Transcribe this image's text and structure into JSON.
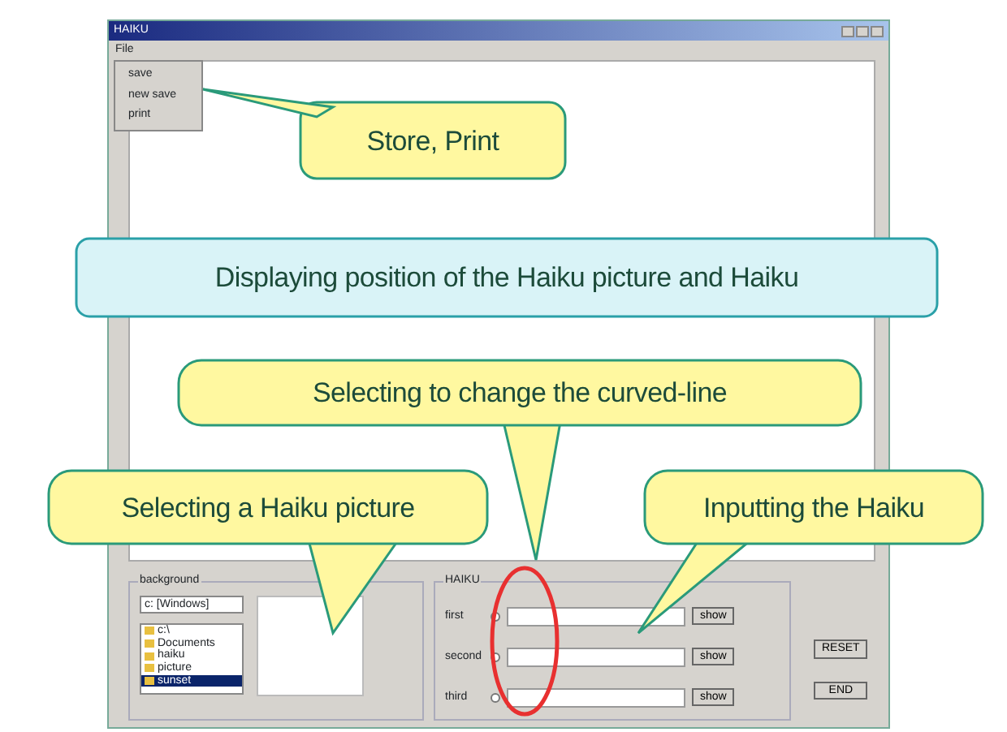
{
  "window": {
    "title": "HAIKU"
  },
  "menu": [
    {
      "label": "File",
      "expanded": true,
      "items": [
        "save",
        "new save",
        "print"
      ]
    }
  ],
  "background_group": {
    "title": "background",
    "drive": "c: [Windows]",
    "folders": [
      {
        "label": "c:\\",
        "selected": false
      },
      {
        "label": "Documents",
        "selected": false
      },
      {
        "label": "haiku",
        "selected": false
      },
      {
        "label": "picture",
        "selected": false
      },
      {
        "label": "sunset",
        "selected": true
      }
    ]
  },
  "haiku_group": {
    "title": "HAIKU",
    "lines": [
      {
        "label": "first",
        "selected": false,
        "button": "show"
      },
      {
        "label": "second",
        "selected": false,
        "button": "show"
      },
      {
        "label": "third",
        "selected": false,
        "button": "show"
      }
    ]
  },
  "buttons": [
    "RESET",
    "END"
  ],
  "callouts": [
    {
      "kind": "yellow",
      "text": "Store, Print"
    },
    {
      "kind": "cyan",
      "text": "Displaying position of the Haiku picture and Haiku"
    },
    {
      "kind": "yellow",
      "text": "Selecting to change the curved-line"
    },
    {
      "kind": "yellow",
      "text": "Selecting a Haiku picture"
    },
    {
      "kind": "yellow",
      "text": "Inputting the Haiku"
    }
  ]
}
